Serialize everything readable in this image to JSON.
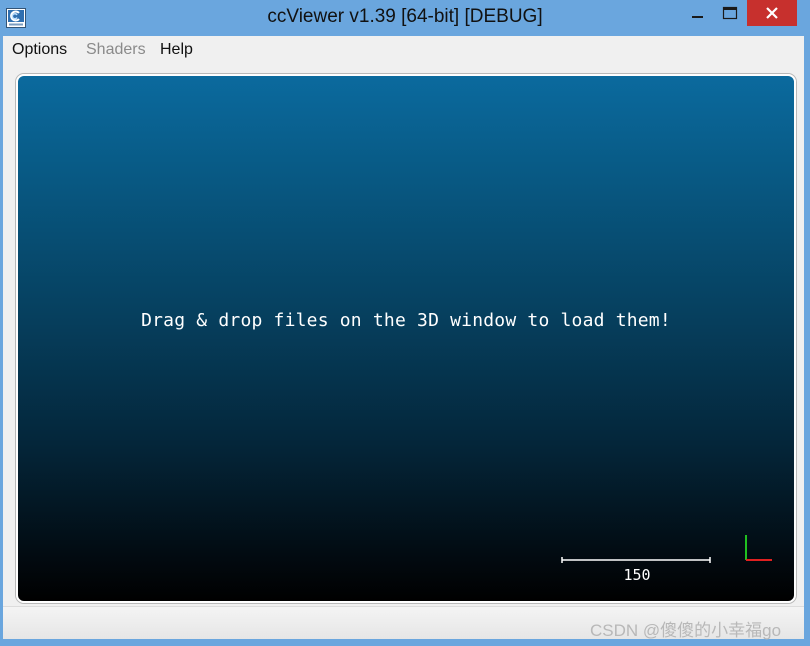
{
  "window": {
    "title": "ccViewer v1.39 [64-bit] [DEBUG]",
    "controls": {
      "minimize_icon": "minimize-icon",
      "maximize_icon": "maximize-icon",
      "close_icon": "close-icon"
    }
  },
  "menu": {
    "items": [
      {
        "label": "Options",
        "enabled": true
      },
      {
        "label": "Shaders",
        "enabled": false
      },
      {
        "label": "Help",
        "enabled": true
      }
    ]
  },
  "viewport": {
    "hint": "Drag & drop files on the 3D window to load them!",
    "scale_label": "150",
    "background_top": "#0b6a9e",
    "background_bottom": "#000000",
    "axis_colors": {
      "x": "#e02020",
      "y": "#20c020"
    }
  },
  "watermark": "CSDN @傻傻的小幸福go"
}
